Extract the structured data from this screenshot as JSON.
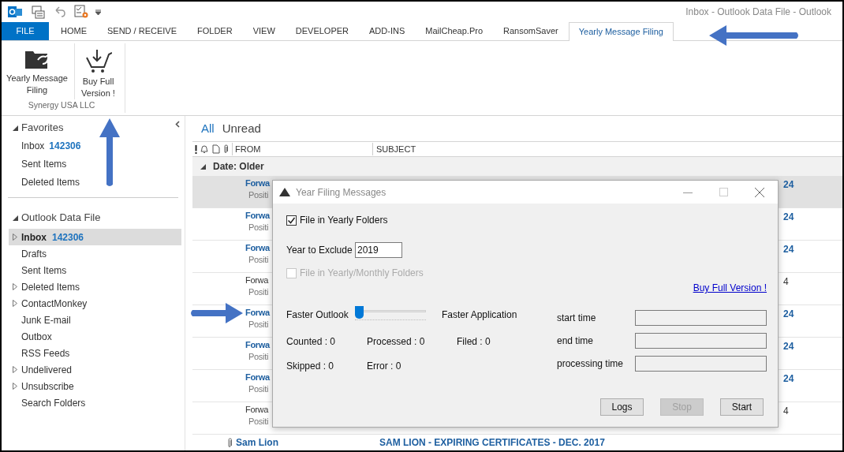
{
  "window": {
    "title": "Inbox - Outlook Data File - Outlook"
  },
  "tabs": [
    {
      "label": "FILE",
      "kind": "file",
      "selected": false
    },
    {
      "label": "HOME",
      "kind": "tab",
      "selected": false
    },
    {
      "label": "SEND / RECEIVE",
      "kind": "tab",
      "selected": false
    },
    {
      "label": "FOLDER",
      "kind": "tab",
      "selected": false
    },
    {
      "label": "VIEW",
      "kind": "tab",
      "selected": false
    },
    {
      "label": "DEVELOPER",
      "kind": "tab",
      "selected": false
    },
    {
      "label": "ADD-INS",
      "kind": "tab",
      "selected": false
    },
    {
      "label": "MailCheap.Pro",
      "kind": "tab",
      "selected": false
    },
    {
      "label": "RansomSaver",
      "kind": "tab",
      "selected": false
    },
    {
      "label": "Yearly Message Filing",
      "kind": "tab",
      "selected": true
    }
  ],
  "ribbon": {
    "group": "Synergy USA LLC",
    "buttons": [
      {
        "label": "Yearly Message Filing",
        "kind": "folder"
      },
      {
        "label": "Buy Full Version !",
        "kind": "cart"
      }
    ]
  },
  "navigation": {
    "favorites": {
      "title": "Favorites",
      "items": [
        {
          "label": "Inbox",
          "count": "142306"
        },
        {
          "label": "Sent Items"
        },
        {
          "label": "Deleted Items"
        }
      ]
    },
    "data_file": {
      "title": "Outlook Data File",
      "folders": [
        {
          "label": "Inbox",
          "count": "142306",
          "expandable": true,
          "selected": true
        },
        {
          "label": "Drafts",
          "expandable": false,
          "selected": false
        },
        {
          "label": "Sent Items",
          "expandable": false,
          "selected": false
        },
        {
          "label": "Deleted Items",
          "expandable": true,
          "selected": false
        },
        {
          "label": "ContactMonkey",
          "expandable": true,
          "selected": false
        },
        {
          "label": "Junk E-mail",
          "expandable": false,
          "selected": false
        },
        {
          "label": "Outbox",
          "expandable": false,
          "selected": false
        },
        {
          "label": "RSS Feeds",
          "expandable": false,
          "selected": false
        },
        {
          "label": "Undelivered",
          "expandable": true,
          "selected": false
        },
        {
          "label": "Unsubscribe",
          "expandable": true,
          "selected": false
        },
        {
          "label": "Search Folders",
          "expandable": false,
          "selected": false
        }
      ]
    }
  },
  "mail_list": {
    "filters": [
      {
        "label": "All",
        "selected": true
      },
      {
        "label": "Unread",
        "selected": false
      }
    ],
    "columns": [
      "FROM",
      "SUBJECT"
    ],
    "group": "Date: Older",
    "rows": [
      {
        "kind": "covered",
        "from": "Forwa",
        "preview": "Positi",
        "time": "24",
        "unread": true,
        "selected": true
      },
      {
        "kind": "covered",
        "from": "Forwa",
        "preview": "Positi",
        "time": "24",
        "unread": true,
        "selected": false
      },
      {
        "kind": "covered",
        "from": "Forwa",
        "preview": "Positi",
        "time": "24",
        "unread": true,
        "selected": false
      },
      {
        "kind": "covered",
        "from": "Forwa",
        "preview": "Positi",
        "time": "4",
        "unread": false,
        "selected": false
      },
      {
        "kind": "covered",
        "from": "Forwa",
        "preview": "Positi",
        "time": "24",
        "unread": true,
        "selected": false
      },
      {
        "kind": "covered",
        "from": "Forwa",
        "preview": "Positi",
        "time": "24",
        "unread": true,
        "selected": false
      },
      {
        "kind": "covered",
        "from": "Forwa",
        "preview": "Positi",
        "time": "24",
        "unread": true,
        "selected": false
      },
      {
        "kind": "covered",
        "from": "Forwa",
        "preview": "Positi",
        "time": "4",
        "unread": false,
        "selected": false
      },
      {
        "kind": "full",
        "from": "Sam Lion",
        "subject": "SAM LION - EXPIRING CERTIFICATES - DEC. 2017",
        "attachment": true,
        "unread": true,
        "selected": false
      }
    ]
  },
  "dialog": {
    "title": "Year Filing Messages",
    "yearly_folders": {
      "label": "File in Yearly Folders",
      "checked": true,
      "disabled": false
    },
    "year_to_exclude": {
      "label": "Year to Exclude",
      "value": "2019"
    },
    "monthly_folders": {
      "label": "File in Yearly/Monthly Folders",
      "checked": false,
      "disabled": true
    },
    "link": "Buy Full Version !",
    "slider": {
      "left_label": "Faster Outlook",
      "right_label": "Faster Application",
      "level": 0
    },
    "stats": [
      [
        "Counted : 0",
        "Processed : 0",
        "Filed : 0"
      ],
      [
        "Skipped : 0",
        "Error : 0"
      ]
    ],
    "times": [
      {
        "label": "start time"
      },
      {
        "label": "end time"
      },
      {
        "label": "processing time"
      }
    ],
    "buttons": [
      {
        "label": "Logs",
        "disabled": false
      },
      {
        "label": "Stop",
        "disabled": true
      },
      {
        "label": "Start",
        "disabled": false
      }
    ]
  }
}
